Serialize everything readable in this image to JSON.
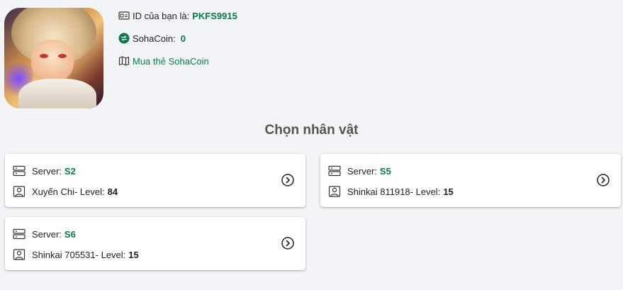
{
  "profile": {
    "id_label": "ID của bạn là:",
    "id_value": "PKFS9915",
    "coin_label": "SohaCoin:",
    "coin_value": "0",
    "buy_link": "Mua thẻ SohaCoin"
  },
  "section_title": "Chọn nhân vật",
  "characters": [
    {
      "server_label": "Server:",
      "server": "S2",
      "name": "Xuyến Chi",
      "level_label": "- Level:",
      "level": "84"
    },
    {
      "server_label": "Server:",
      "server": "S5",
      "name": "Shinkai 811918",
      "level_label": "- Level:",
      "level": "15"
    },
    {
      "server_label": "Server:",
      "server": "S6",
      "name": "Shinkai 705531",
      "level_label": "- Level:",
      "level": "15"
    }
  ],
  "colors": {
    "accent": "#0b7a47",
    "background": "#f3f4f6"
  },
  "icons": {
    "id_card": "id-card-icon",
    "coin": "sohacoin-icon",
    "map": "map-icon",
    "server": "server-icon",
    "user": "user-icon",
    "chevron": "chevron-right-circle-icon"
  }
}
